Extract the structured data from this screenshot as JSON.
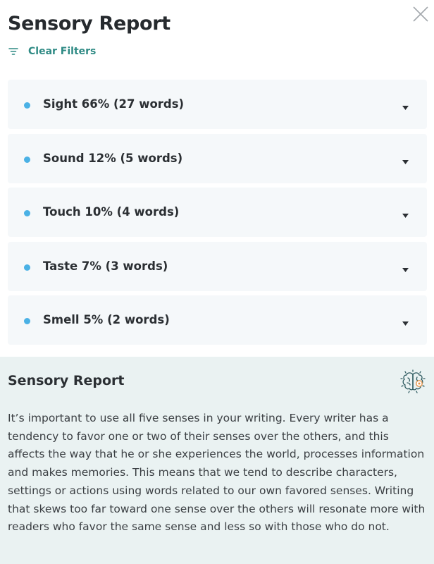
{
  "report": {
    "title": "Sensory Report",
    "clear_filters_label": "Clear Filters"
  },
  "senses": [
    {
      "label": "Sight 66% (27 words)"
    },
    {
      "label": "Sound 12% (5 words)"
    },
    {
      "label": "Touch 10% (4 words)"
    },
    {
      "label": "Taste 7% (3 words)"
    },
    {
      "label": "Smell 5% (2 words)"
    }
  ],
  "info": {
    "title": "Sensory Report",
    "body": "It’s important to use all five senses in your writing. Every writer has a tendency to favor one or two of their senses over the others, and this affects the way that he or she experiences the world, processes information and makes memories. This means that we tend to describe characters, settings or actions using words related to our own favored senses. Writing that skews too far toward one sense over the others will resonate more with readers who favor the same sense and less so with those who do not."
  },
  "icons": {
    "close": "close-icon",
    "filter": "filter-icon",
    "chevron": "chevron-down-icon",
    "brain": "brain-icon"
  },
  "colors": {
    "accent_teal": "#2e8a84",
    "dot_blue": "#4ab1e5",
    "item_bg": "#f5f8fa",
    "info_bg": "#eaf2f2",
    "brain_orange": "#e8954a"
  }
}
